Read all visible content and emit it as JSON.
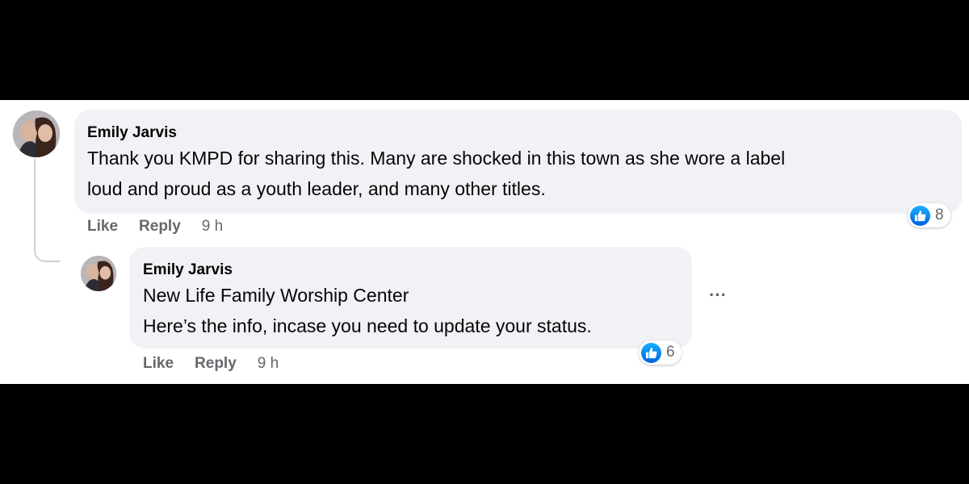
{
  "comments": [
    {
      "author": "Emily Jarvis",
      "lines": [
        "Thank you KMPD for sharing this. Many are shocked in this town as she wore a label",
        "loud and proud as a youth leader, and many other titles."
      ],
      "like_label": "Like",
      "reply_label": "Reply",
      "time": "9 h",
      "reaction_icon": "like-icon",
      "reaction_count": "8"
    },
    {
      "author": "Emily Jarvis",
      "lines": [
        "New Life Family Worship Center",
        "Here’s the info, incase you need to update your status."
      ],
      "like_label": "Like",
      "reply_label": "Reply",
      "time": "9 h",
      "reaction_icon": "like-icon",
      "reaction_count": "6",
      "more_label": "···"
    }
  ],
  "colors": {
    "bubble": "#f0f2f5",
    "text": "#050505",
    "secondary": "#65676b",
    "like_blue": "#0866ff",
    "letterbox": "#000000"
  }
}
